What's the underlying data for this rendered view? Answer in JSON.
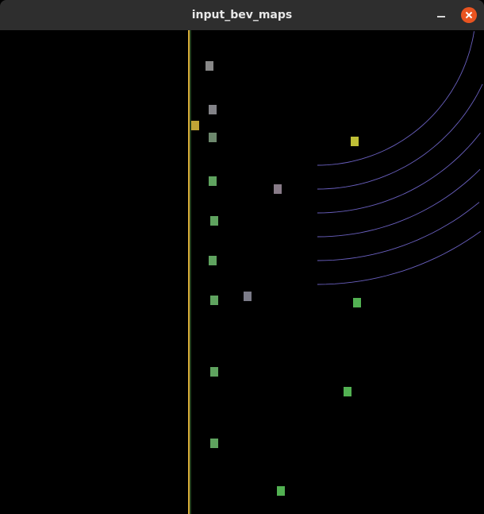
{
  "window": {
    "title": "input_bev_maps",
    "buttons": {
      "minimize": "minimize-icon",
      "close": "close-icon"
    },
    "close_color": "#e95420"
  },
  "bev_map": {
    "background": "#000000",
    "palette": [
      "#f0c040",
      "#8ad060",
      "#c07050",
      "#7060c0",
      "#60d060"
    ]
  }
}
